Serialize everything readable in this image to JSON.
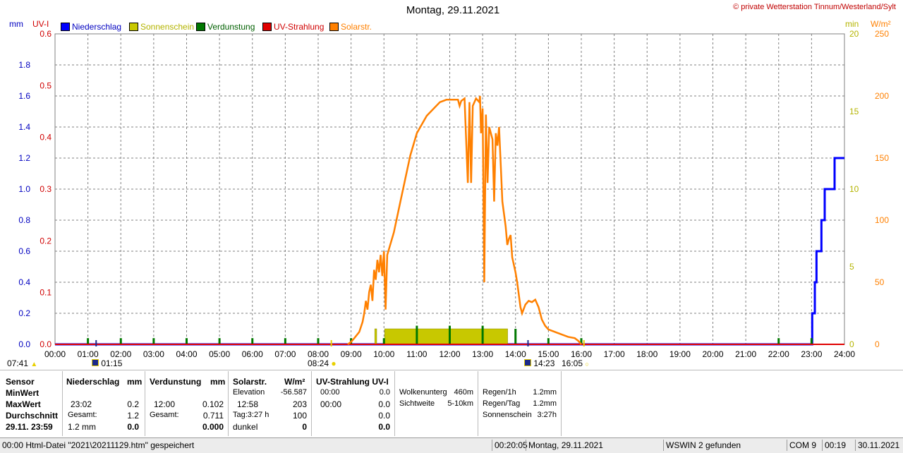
{
  "title": "Montag, 29.11.2021",
  "copyright": "© private Wetterstation Tinnum/Westerland/Sylt",
  "axis_units": {
    "left_outer": "mm",
    "left_inner": "UV-I",
    "right_inner": "min",
    "right_outer": "W/m²"
  },
  "legend": [
    {
      "label": "Niederschlag",
      "color": "#0000ff",
      "text_color": "#0000c0"
    },
    {
      "label": "Sonnenschein",
      "color": "#c8c800",
      "text_color": "#b4b400"
    },
    {
      "label": "Verdunstung",
      "color": "#007800",
      "text_color": "#006000"
    },
    {
      "label": "UV-Strahlung",
      "color": "#e00000",
      "text_color": "#d00000"
    },
    {
      "label": "Solarstr.",
      "color": "#ff8000",
      "text_color": "#ff8000"
    }
  ],
  "sun_events": [
    {
      "label": "07:41",
      "icon": "sun-low-icon"
    },
    {
      "label": "01:15",
      "icon": "moon-icon"
    },
    {
      "label": "08:24",
      "icon": "sunrise-icon"
    },
    {
      "label": "14:23",
      "icon": "moon-icon"
    },
    {
      "label": "16:05",
      "icon": "sunset-icon"
    }
  ],
  "chart_data": {
    "type": "line",
    "title": "Montag, 29.11.2021",
    "x_unit": "hours",
    "xlim": [
      0,
      24
    ],
    "x_ticks": [
      "00:00",
      "01:00",
      "02:00",
      "03:00",
      "04:00",
      "05:00",
      "06:00",
      "07:00",
      "08:00",
      "09:00",
      "10:00",
      "11:00",
      "12:00",
      "13:00",
      "14:00",
      "15:00",
      "16:00",
      "17:00",
      "18:00",
      "19:00",
      "20:00",
      "21:00",
      "22:00",
      "23:00",
      "24:00"
    ],
    "axes": {
      "mm": {
        "ylim": [
          0,
          2.0
        ],
        "ticks": [
          "0.0",
          "0.2",
          "0.4",
          "0.6",
          "0.8",
          "1.0",
          "1.2",
          "1.4",
          "1.6",
          "1.8"
        ]
      },
      "uv": {
        "ylim": [
          0,
          0.6
        ],
        "ticks": [
          "0.0",
          "0.1",
          "0.2",
          "0.3",
          "0.4",
          "0.5",
          "0.6"
        ]
      },
      "min": {
        "ylim": [
          0,
          20
        ],
        "ticks": [
          "0",
          "5",
          "10",
          "15",
          "20"
        ]
      },
      "wm2": {
        "ylim": [
          0,
          250
        ],
        "ticks": [
          "0",
          "50",
          "100",
          "150",
          "200",
          "250"
        ]
      }
    },
    "grid": true,
    "series": [
      {
        "name": "Niederschlag",
        "axis": "mm",
        "color": "#0000ff",
        "style": "step",
        "points": [
          [
            0,
            0
          ],
          [
            23.0,
            0
          ],
          [
            23.02,
            0.2
          ],
          [
            23.1,
            0.4
          ],
          [
            23.15,
            0.6
          ],
          [
            23.3,
            0.8
          ],
          [
            23.4,
            1.0
          ],
          [
            23.7,
            1.2
          ],
          [
            24,
            1.2
          ]
        ]
      },
      {
        "name": "Sonnenschein",
        "axis": "min",
        "color": "#c8c800",
        "style": "bars",
        "intervals": [
          [
            9.72,
            9.78,
            1.0
          ],
          [
            10.02,
            13.76,
            1.0
          ]
        ]
      },
      {
        "name": "Verdunstung",
        "axis": "mm",
        "color": "#007800",
        "style": "ticks",
        "times": [
          1.0,
          2.0,
          3.0,
          4.0,
          5.0,
          6.0,
          7.0,
          8.0,
          9.0,
          10.0,
          11.0,
          12.0,
          13.0,
          14.0,
          15.0,
          16.0,
          22.0,
          23.0
        ],
        "values": [
          0.04,
          0.04,
          0.04,
          0.04,
          0.04,
          0.04,
          0.04,
          0.04,
          0.04,
          0.04,
          0.12,
          0.12,
          0.12,
          0.1,
          0.04,
          0.04,
          0.04,
          0.04
        ]
      },
      {
        "name": "UV-Strahlung",
        "axis": "uv",
        "color": "#e00000",
        "style": "line",
        "points": [
          [
            0,
            0
          ],
          [
            24,
            0
          ]
        ]
      },
      {
        "name": "Solarstr.",
        "axis": "wm2",
        "color": "#ff8000",
        "style": "line",
        "points": [
          [
            8.9,
            0
          ],
          [
            9.0,
            2
          ],
          [
            9.1,
            5
          ],
          [
            9.25,
            10
          ],
          [
            9.35,
            18
          ],
          [
            9.4,
            25
          ],
          [
            9.45,
            35
          ],
          [
            9.5,
            28
          ],
          [
            9.55,
            42
          ],
          [
            9.6,
            48
          ],
          [
            9.65,
            35
          ],
          [
            9.7,
            60
          ],
          [
            9.75,
            52
          ],
          [
            9.8,
            68
          ],
          [
            9.85,
            58
          ],
          [
            9.9,
            72
          ],
          [
            9.95,
            55
          ],
          [
            10.0,
            75
          ],
          [
            10.05,
            28
          ],
          [
            10.1,
            72
          ],
          [
            10.3,
            90
          ],
          [
            10.5,
            115
          ],
          [
            10.8,
            152
          ],
          [
            11.0,
            170
          ],
          [
            11.3,
            184
          ],
          [
            11.7,
            195
          ],
          [
            11.9,
            197
          ],
          [
            12.1,
            197
          ],
          [
            12.25,
            197
          ],
          [
            12.3,
            192
          ],
          [
            12.35,
            196
          ],
          [
            12.45,
            198
          ],
          [
            12.55,
            130
          ],
          [
            12.6,
            195
          ],
          [
            12.65,
            130
          ],
          [
            12.7,
            192
          ],
          [
            12.8,
            198
          ],
          [
            12.9,
            195
          ],
          [
            12.92,
            200
          ],
          [
            12.95,
            170
          ],
          [
            13.0,
            190
          ],
          [
            13.05,
            50
          ],
          [
            13.1,
            185
          ],
          [
            13.15,
            130
          ],
          [
            13.2,
            175
          ],
          [
            13.3,
            165
          ],
          [
            13.35,
            115
          ],
          [
            13.4,
            170
          ],
          [
            13.45,
            160
          ],
          [
            13.5,
            175
          ],
          [
            13.55,
            145
          ],
          [
            13.6,
            115
          ],
          [
            13.7,
            95
          ],
          [
            13.75,
            80
          ],
          [
            13.8,
            85
          ],
          [
            13.85,
            88
          ],
          [
            13.9,
            70
          ],
          [
            14.0,
            58
          ],
          [
            14.05,
            50
          ],
          [
            14.1,
            40
          ],
          [
            14.15,
            30
          ],
          [
            14.2,
            25
          ],
          [
            14.3,
            32
          ],
          [
            14.4,
            35
          ],
          [
            14.5,
            34
          ],
          [
            14.6,
            36
          ],
          [
            14.7,
            30
          ],
          [
            14.8,
            20
          ],
          [
            14.9,
            15
          ],
          [
            15.0,
            12
          ],
          [
            15.2,
            10
          ],
          [
            15.4,
            8
          ],
          [
            15.6,
            6
          ],
          [
            15.8,
            5
          ],
          [
            15.9,
            3
          ],
          [
            16.0,
            0
          ]
        ]
      }
    ]
  },
  "summary": {
    "sensor_col": {
      "header": "Sensor",
      "rows": [
        "MinWert",
        "MaxWert",
        "Durchschnitt",
        "29.11. 23:59"
      ]
    },
    "niederschlag": {
      "header": "Niederschlag",
      "unit": "mm",
      "rows": [
        [
          "23:02",
          "0.2"
        ],
        [
          "Gesamt:",
          "1.2"
        ],
        [
          "1.2 mm",
          "0.0"
        ]
      ]
    },
    "verdunstung": {
      "header": "Verdunstung",
      "unit": "mm",
      "rows": [
        [
          "12:00",
          "0.102"
        ],
        [
          "Gesamt:",
          "0.711"
        ],
        [
          "",
          "0.000"
        ]
      ]
    },
    "solar": {
      "header": "Solarstr.",
      "unit": "W/m²",
      "rows": [
        [
          "Elevation",
          "-56.587"
        ],
        [
          "12:58",
          "203"
        ],
        [
          "Tag:3:27 h",
          "100"
        ],
        [
          "dunkel",
          "0"
        ]
      ]
    },
    "uv": {
      "header": "UV-Strahlung UV-I",
      "rows": [
        [
          "00:00",
          "0.0"
        ],
        [
          "00:00",
          "0.0"
        ],
        [
          "",
          "0.0"
        ],
        [
          "",
          "0.0"
        ]
      ]
    },
    "cloud": {
      "rows": [
        [
          "Wolkenunterg",
          "460m"
        ],
        [
          "Sichtweite",
          "5-10km"
        ]
      ]
    },
    "rain": {
      "rows": [
        [
          "Regen/1h",
          "1.2mm"
        ],
        [
          "Regen/Tag",
          "1.2mm"
        ],
        [
          "Sonnenschein",
          "3:27h"
        ]
      ]
    }
  },
  "statusbar": {
    "file_msg": "00:00  Html-Datei  \"2021\\20211129.htm\"  gespeichert",
    "time": "00:20:05",
    "date": "Montag, 29.11.2021",
    "wswin": "WSWIN 2 gefunden",
    "com": "COM 9",
    "clock": "00:19",
    "today": "30.11.2021"
  }
}
